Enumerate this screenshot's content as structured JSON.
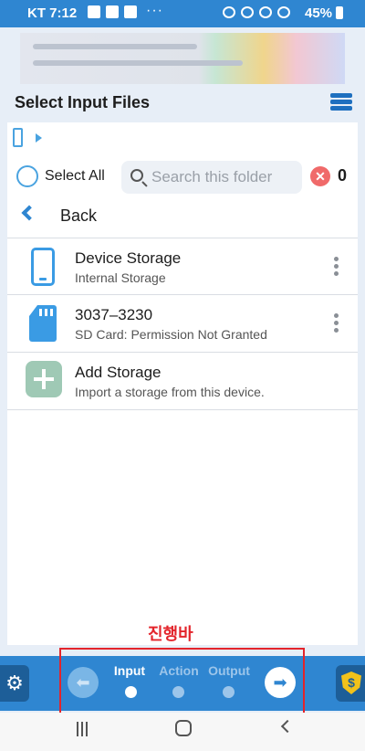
{
  "status_bar": {
    "carrier_time": "KT 7:12",
    "dots": "···",
    "battery": "45%"
  },
  "header": {
    "title": "Select Input Files",
    "menu_icon": "menu-list-icon"
  },
  "toolbar": {
    "select_all": "Select All",
    "search_placeholder": "Search this folder",
    "selected_count": "0"
  },
  "back": {
    "label": "Back"
  },
  "storage_list": [
    {
      "title": "Device Storage",
      "subtitle": "Internal Storage",
      "icon": "phone-icon"
    },
    {
      "title": "3037–3230",
      "subtitle": "SD Card: Permission Not Granted",
      "icon": "sd-card-icon"
    },
    {
      "title": "Add Storage",
      "subtitle": "Import a storage from this device.",
      "icon": "add-icon"
    }
  ],
  "annotation": {
    "label": "진행바",
    "color": "#e3242b"
  },
  "progress": {
    "steps": [
      "Input",
      "Action",
      "Output"
    ],
    "current_step": "Input"
  },
  "colors": {
    "accent": "#2f86d1",
    "panel": "#ffffff",
    "background": "#e7eef7"
  }
}
